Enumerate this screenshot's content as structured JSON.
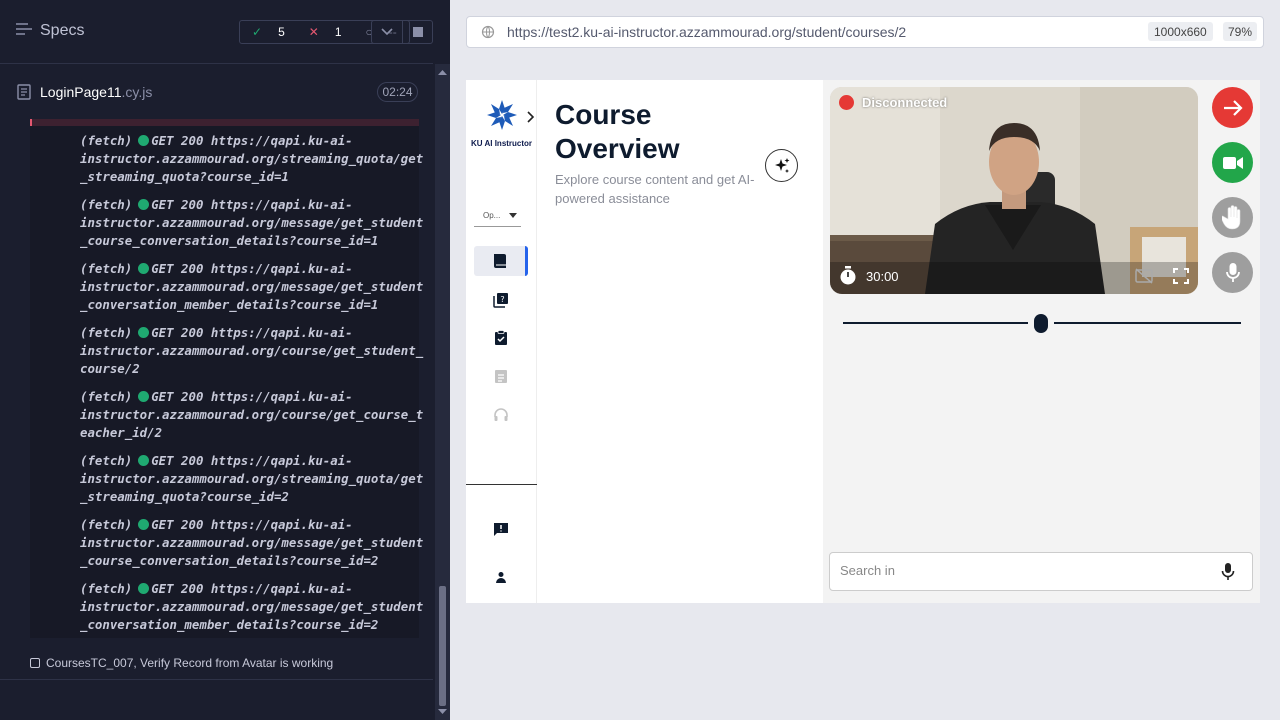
{
  "runner": {
    "title": "Specs",
    "passed": "5",
    "failed": "1",
    "pending": "--",
    "file_name": "LoginPage11",
    "file_ext": ".cy.js",
    "duration": "02:24",
    "log_entries": [
      {
        "prefix": "(fetch)",
        "line1": "GET 200 https://qapi.ku-ai-",
        "line2": "instructor.azzammourad.org/streaming_quota/get",
        "line3": "_streaming_quota?course_id=1"
      },
      {
        "prefix": "(fetch)",
        "line1": "GET 200 https://qapi.ku-ai-",
        "line2": "instructor.azzammourad.org/message/get_student",
        "line3": "_course_conversation_details?course_id=1"
      },
      {
        "prefix": "(fetch)",
        "line1": "GET 200 https://qapi.ku-ai-",
        "line2": "instructor.azzammourad.org/message/get_student",
        "line3": "_conversation_member_details?course_id=1"
      },
      {
        "prefix": "(fetch)",
        "line1": "GET 200 https://qapi.ku-ai-",
        "line2": "instructor.azzammourad.org/course/get_student_",
        "line3": "course/2"
      },
      {
        "prefix": "(fetch)",
        "line1": "GET 200 https://qapi.ku-ai-",
        "line2": "instructor.azzammourad.org/course/get_course_t",
        "line3": "eacher_id/2"
      },
      {
        "prefix": "(fetch)",
        "line1": "GET 200 https://qapi.ku-ai-",
        "line2": "instructor.azzammourad.org/streaming_quota/get",
        "line3": "_streaming_quota?course_id=2"
      },
      {
        "prefix": "(fetch)",
        "line1": "GET 200 https://qapi.ku-ai-",
        "line2": "instructor.azzammourad.org/message/get_student",
        "line3": "_course_conversation_details?course_id=2"
      },
      {
        "prefix": "(fetch)",
        "line1": "GET 200 https://qapi.ku-ai-",
        "line2": "instructor.azzammourad.org/message/get_student",
        "line3": "_conversation_member_details?course_id=2"
      }
    ],
    "test_title": "CoursesTC_007, Verify Record from Avatar is working"
  },
  "browser": {
    "url": "https://test2.ku-ai-instructor.azzammourad.org/student/courses/2",
    "viewport": "1000x660",
    "zoom": "79%"
  },
  "app": {
    "brand": "KU AI Instructor",
    "dropdown_value": "Op...",
    "page_title": "Course Overview",
    "page_subtitle": "Explore course content and get AI-powered assistance",
    "video_status": "Disconnected",
    "video_timer": "30:00",
    "search_placeholder": "Search in"
  },
  "colors": {
    "pass": "#1fa971",
    "fail": "#e45770",
    "exit_button": "#e53935",
    "camera_button": "#22a64a",
    "disabled_button": "#9e9e9e",
    "nav_active": "#2563eb"
  }
}
